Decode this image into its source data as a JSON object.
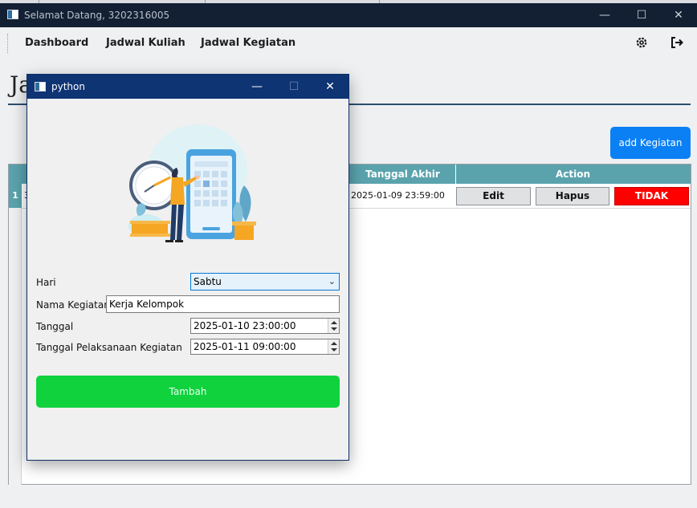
{
  "main_window": {
    "title": "Selamat Datang, 3202316005",
    "nav": [
      "Dashboard",
      "Jadwal Kuliah",
      "Jadwal Kegiatan"
    ],
    "page_title_partial": "Ja",
    "add_button": "add Kegiatan",
    "table": {
      "headers": [
        "Tanggal Akhir Kegiatan",
        "Action"
      ],
      "rows": [
        {
          "num": "1",
          "first_cell_partial": "3",
          "tanggal_akhir": "2025-01-09 23:59:00",
          "edit": "Edit",
          "hapus": "Hapus",
          "status": "TIDAK SELESAI"
        }
      ]
    }
  },
  "dialog": {
    "title": "python",
    "fields": {
      "hari_label": "Hari",
      "hari_value": "Sabtu",
      "nama_label": "Nama Kegiatan",
      "nama_value": "Kerja Kelompok",
      "tanggal_label": "Tanggal",
      "tanggal_value": "2025-01-10 23:00:00",
      "pelaksanaan_label": "Tanggal Pelaksanaan Kegiatan",
      "pelaksanaan_value": "2025-01-11 09:00:00"
    },
    "submit": "Tambah"
  },
  "colors": {
    "titlebar": "#132033",
    "dialog_titlebar": "#0e3473",
    "table_header": "#5aa3ad",
    "add_button": "#0b80f5",
    "tambah_button": "#0fd23d",
    "status_red": "#ff0000"
  }
}
